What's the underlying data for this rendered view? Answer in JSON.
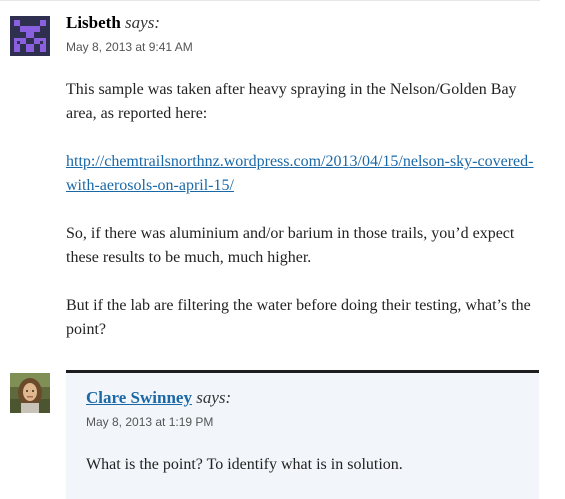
{
  "comment": {
    "author": "Lisbeth",
    "says": "says:",
    "date": "May 8, 2013 at 9:41 AM",
    "avatar": "identicon-avatar",
    "paragraphs": [
      "This sample was taken after heavy spraying in the Nelson/Golden Bay area, as reported here:",
      "So, if there was aluminium and/or barium in those trails, you’d expect these results to be much, much higher.",
      "But if the lab are filtering the water before doing their testing, what’s the point?"
    ],
    "link": "http://chemtrailsnorthnz.wordpress.com/2013/04/15/nelson-sky-covered-with-aerosols-on-april-15/"
  },
  "reply": {
    "author": "Clare Swinney",
    "says": "says:",
    "date": "May 8, 2013 at 1:19 PM",
    "avatar": "photo-avatar",
    "text": "What is the point? To identify what is in solution."
  },
  "colors": {
    "link": "#1b68a7",
    "reply_background": "#f2f6fa",
    "reply_border": "#1e1e1e",
    "identicon_bg": "#2f2f4f",
    "identicon_fg": "#8a5fe0"
  }
}
